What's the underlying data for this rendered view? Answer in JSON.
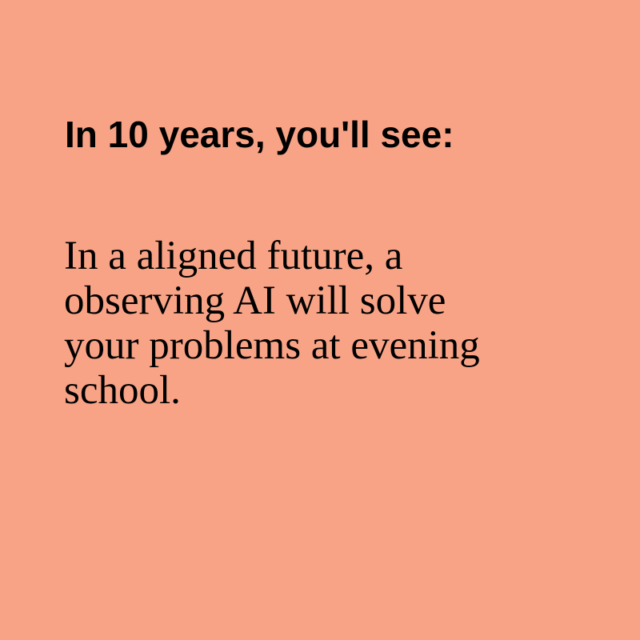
{
  "card": {
    "background_color": "#f8a386",
    "heading": "In 10 years, you'll see:",
    "body_lines": [
      "In a aligned future, a",
      "observing AI will solve",
      "your problems at evening",
      "school."
    ]
  }
}
